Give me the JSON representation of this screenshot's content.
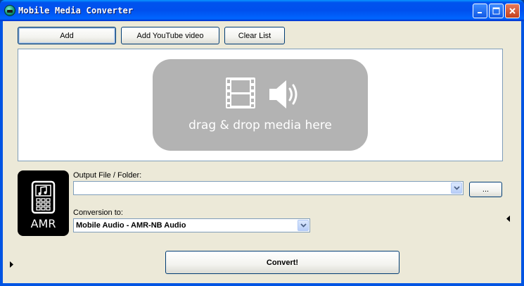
{
  "window": {
    "title": "Mobile Media Converter",
    "controls": [
      "minimize-icon",
      "maximize-icon",
      "close-icon"
    ]
  },
  "toolbar": {
    "add_label": "Add",
    "add_youtube_label": "Add YouTube video",
    "clear_list_label": "Clear List"
  },
  "dropzone": {
    "text": "drag & drop media here",
    "icons": [
      "film-icon",
      "speaker-icon"
    ]
  },
  "format_tile": {
    "label": "AMR",
    "icon": "phone-music-icon"
  },
  "output": {
    "label": "Output File / Folder:",
    "value": "",
    "browse_label": "..."
  },
  "conversion": {
    "label": "Conversion to:",
    "selected": "Mobile Audio - AMR-NB Audio"
  },
  "actions": {
    "convert_label": "Convert!"
  },
  "colors": {
    "titlebar": "#0054e3",
    "client_bg": "#ece9d8",
    "drop_pill": "#b3b3b3",
    "tile_bg": "#000000"
  }
}
